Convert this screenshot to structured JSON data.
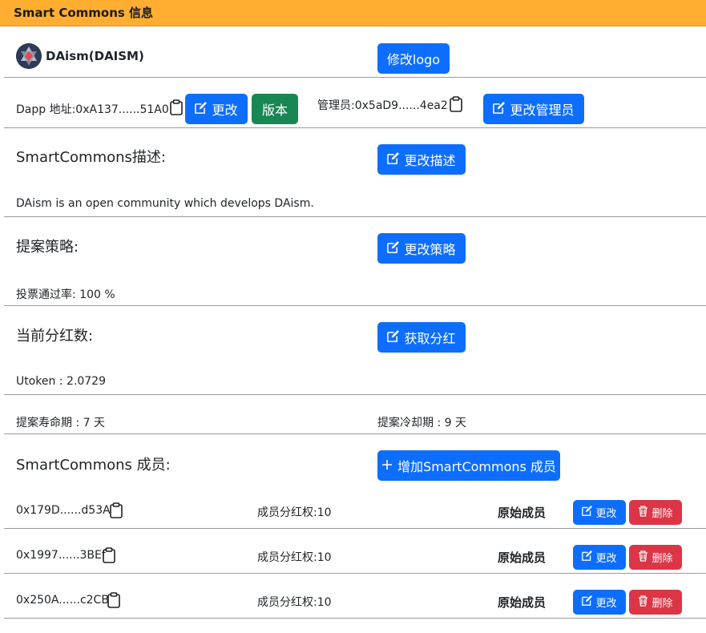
{
  "header": {
    "title": "Smart Commons 信息"
  },
  "dao": {
    "name": "DAism(DAISM)",
    "logo_button": "修改logo"
  },
  "address_row": {
    "dapp_address": "Dapp 地址:0xA137......51A0",
    "change_button": "更改",
    "version_button": "版本",
    "manager": "管理员:0x5aD9......4ea2",
    "change_manager_button": "更改管理员"
  },
  "description": {
    "heading": "SmartCommons描述:",
    "edit_button": "更改描述",
    "text": "DAism is an open community which develops DAism."
  },
  "strategy": {
    "heading": "提案策略:",
    "edit_button": "更改策略",
    "pass_rate": "投票通过率: 100 %"
  },
  "dividend": {
    "heading": "当前分红数:",
    "get_button": "获取分红",
    "utoken": "Utoken : 2.0729"
  },
  "periods": {
    "lifetime": "提案寿命期 : 7 天",
    "cooldown": "提案冷却期 : 9 天"
  },
  "members": {
    "heading": "SmartCommons 成员:",
    "add_button": "增加SmartCommons 成员",
    "rows": [
      {
        "address": "0x179D......d53A",
        "weight": "成员分红权:10",
        "role": "原始成员",
        "edit": "更改",
        "delete": "删除"
      },
      {
        "address": "0x1997......3BEf",
        "weight": "成员分红权:10",
        "role": "原始成员",
        "edit": "更改",
        "delete": "删除"
      },
      {
        "address": "0x250A......c2CB",
        "weight": "成员分红权:10",
        "role": "原始成员",
        "edit": "更改",
        "delete": "删除"
      }
    ]
  },
  "colors": {
    "header": "#ffae32",
    "primary": "#0d6efd",
    "success": "#198754",
    "danger": "#dc3545"
  },
  "icons": [
    "clipboard-icon",
    "edit-icon",
    "plus-icon",
    "trash-icon",
    "dao-logo"
  ]
}
